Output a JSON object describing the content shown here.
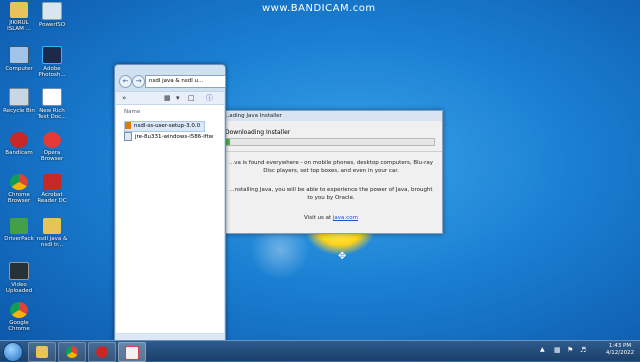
{
  "watermark": "www.BANDICAM.com",
  "desktop_icons": [
    {
      "label": "JIKIRUL ISLAM ..."
    },
    {
      "label": "PowerISO"
    },
    {
      "label": "Computer"
    },
    {
      "label": "Adobe Photosh..."
    },
    {
      "label": "Recycle Bin"
    },
    {
      "label": "New Rich Text Doc..."
    },
    {
      "label": "Bandicam"
    },
    {
      "label": "Opera Browser"
    },
    {
      "label": "Chrome Browser"
    },
    {
      "label": "Acrobat Reader DC"
    },
    {
      "label": "DriverPack"
    },
    {
      "label": "nsdl java & nsdl tr..."
    },
    {
      "label": "Video Uploaded"
    },
    {
      "label": "Google Chrome"
    }
  ],
  "explorer": {
    "address": "nsdl java & nsdl u...",
    "column_name": "Name",
    "files": [
      {
        "name": "nsdl-ss-user-setup-3.0.0"
      },
      {
        "name": "jre-8u331-windows-i586-iftw"
      }
    ]
  },
  "java": {
    "title": "...ading Java Installer",
    "heading": "Downloading Installer",
    "progress": 0.02,
    "text1": "...va is found everywhere - on mobile phones, desktop computers, Blu-ray Disc players, set top boxes, and even in your car.",
    "text2": "...nstalling Java, you will be able to experience the power of Java, brought to you by Oracle.",
    "visit_prefix": "Visit us at",
    "visit_link": "java.com"
  },
  "taskbar": {
    "time": "1:43 PM",
    "date": "4/12/2022"
  },
  "colors": {
    "desktop": "#1a7fd2",
    "progress": "#4fb34f",
    "link": "#1a55c9"
  }
}
